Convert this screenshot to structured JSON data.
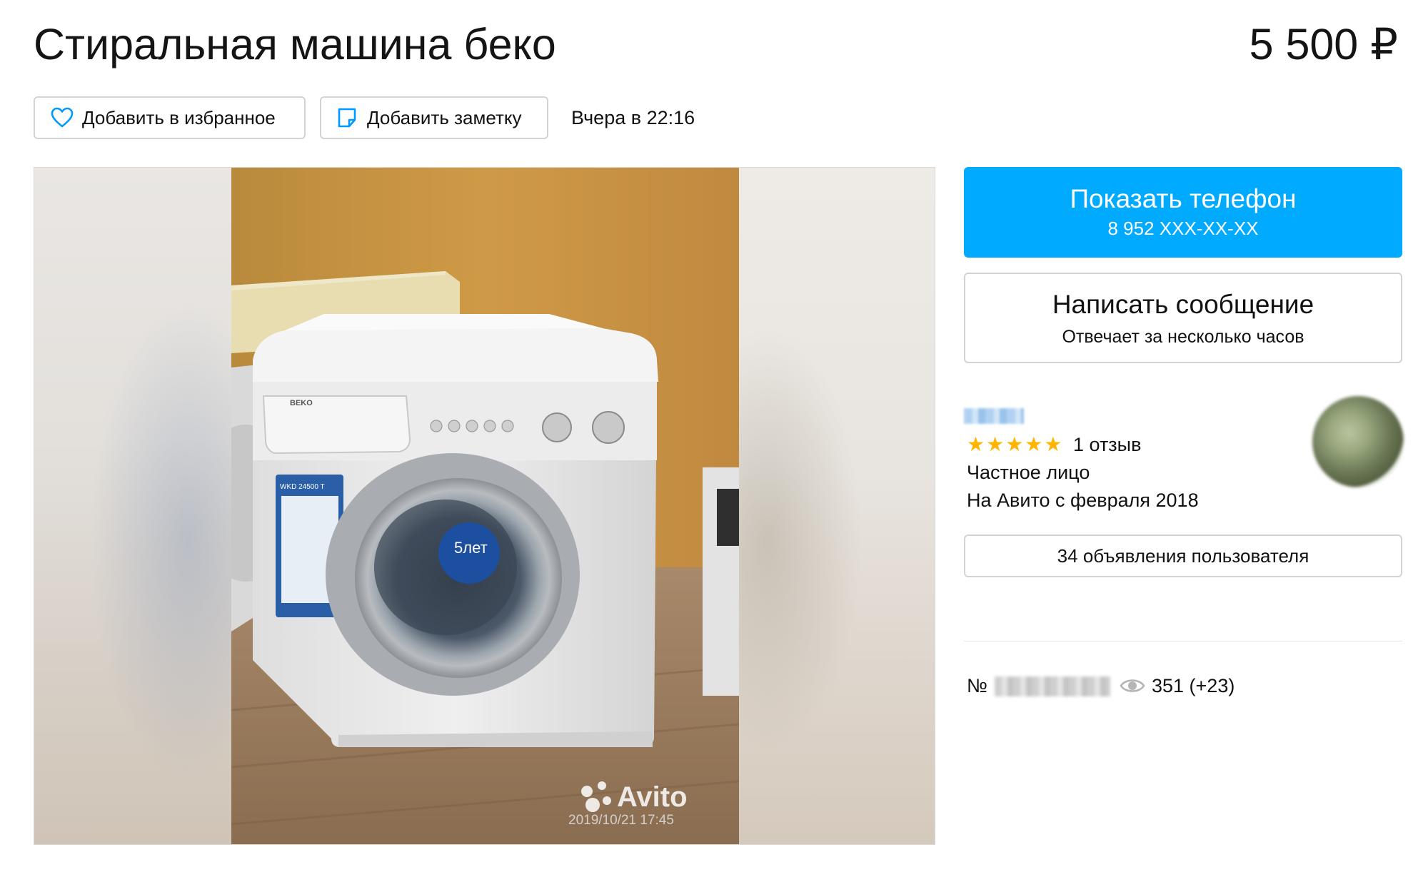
{
  "listing": {
    "title": "Стиральная машина беко",
    "price": "5 500 ₽",
    "posted": "Вчера в 22:16"
  },
  "actions": {
    "favorite_label": "Добавить в избранное",
    "note_label": "Добавить заметку"
  },
  "contact": {
    "show_phone_label": "Показать телефон",
    "phone_masked": "8 952 XXX-XX-XX",
    "message_label": "Написать сообщение",
    "response_time": "Отвечает за несколько часов"
  },
  "seller": {
    "stars": "★★★★★",
    "rating": 5,
    "reviews": "1 отзыв",
    "type": "Частное лицо",
    "since": "На Авито с февраля 2018",
    "ads_button": "34 объявления пользователя"
  },
  "stats": {
    "number_prefix": "№",
    "views": "351 (+23)"
  },
  "photo": {
    "brand": "BEKO",
    "model": "WKD 24500 T",
    "sticker": "5лет",
    "watermark": "Avito",
    "timestamp": "2019/10/21 17:45"
  },
  "colors": {
    "accent": "#00aaff",
    "star": "#ffb400",
    "border": "#d3d3d3",
    "heart_icon": "#0099ff"
  },
  "icons": {
    "favorite": "heart-icon",
    "note": "note-icon",
    "views": "eye-icon"
  }
}
